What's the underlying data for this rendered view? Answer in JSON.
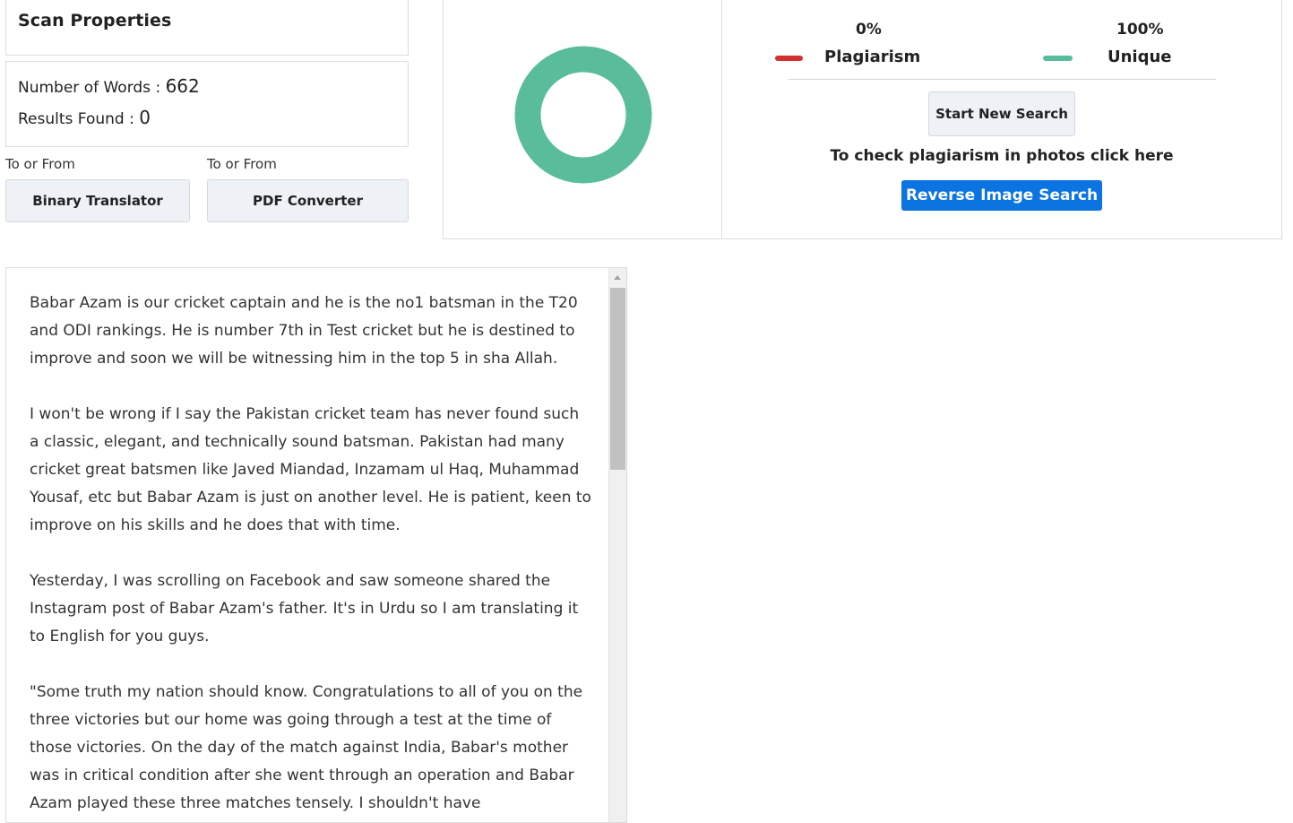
{
  "scan": {
    "title": "Scan Properties",
    "words_label": "Number of Words : ",
    "words_value": "662",
    "results_label": "Results Found : ",
    "results_value": "0"
  },
  "tools": [
    {
      "caption": "To or From",
      "button": "Binary Translator"
    },
    {
      "caption": "To or From",
      "button": "PDF Converter"
    }
  ],
  "result": {
    "plagiarism_pct": "0%",
    "plagiarism_label": "Plagiarism",
    "unique_pct": "100%",
    "unique_label": "Unique",
    "plagiarism_fraction": 0,
    "unique_fraction": 1,
    "plagiarism_color": "#d32f2f",
    "unique_color": "#59bd9c"
  },
  "actions": {
    "start_new_search": "Start New Search",
    "photo_text": "To check plagiarism in photos click here",
    "reverse_image_search": "Reverse Image Search"
  },
  "document": {
    "paragraphs": [
      "Babar Azam is our cricket captain and he is the no1 batsman in the T20 and ODI rankings. He is number 7th in Test cricket but he is destined to improve and soon we will be witnessing him in the top 5 in sha Allah.",
      "I won't be wrong if I say the Pakistan cricket team has never found such a classic, elegant, and technically sound batsman. Pakistan had many cricket great batsmen like Javed Miandad, Inzamam ul Haq, Muhammad Yousaf, etc but Babar Azam is just on another level. He is patient, keen to improve on his skills and he does that with time.",
      "Yesterday, I was scrolling on Facebook and saw someone shared the Instagram post of Babar Azam's father. It's in Urdu so I am translating it to English for you guys.",
      "\"Some truth my nation should know. Congratulations to all of you on the three victories but our home was going through a test at the time of those victories. On the day of the match against India, Babar's mother was in critical condition after she went through an operation and Babar Azam played these three matches tensely. I shouldn't have"
    ]
  }
}
